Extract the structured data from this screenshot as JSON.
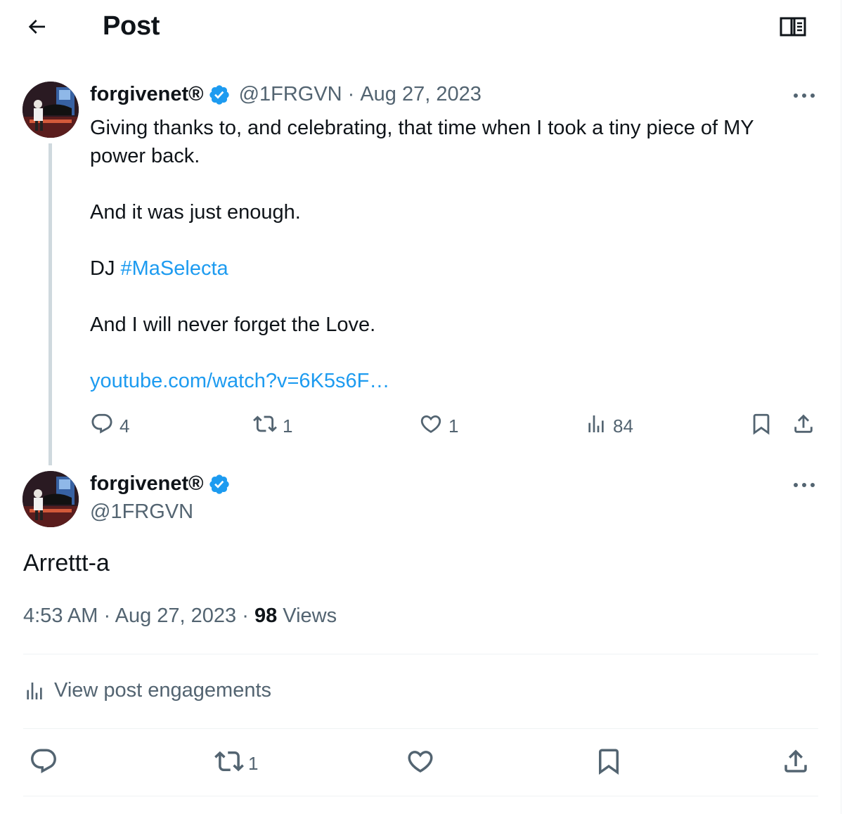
{
  "header": {
    "title": "Post",
    "back_icon": "arrow-left-icon",
    "reader_icon": "book-icon"
  },
  "parent_post": {
    "display_name": "forgivenet®",
    "handle": "@1FRGVN",
    "separator": "·",
    "date": "Aug 27, 2023",
    "text": {
      "line1": "Giving thanks to, and celebrating, that time when I took a tiny piece of MY power back.",
      "line2": "And it was just enough.",
      "dj_prefix": "DJ ",
      "hashtag": "#MaSelecta",
      "line4": "And I will never forget the Love.",
      "link": "youtube.com/watch?v=6K5s6F…"
    },
    "actions": {
      "replies": "4",
      "reposts": "1",
      "likes": "1",
      "views": "84"
    }
  },
  "main_post": {
    "display_name": "forgivenet®",
    "handle": "@1FRGVN",
    "text": "Arrettt-a",
    "time": "4:53 AM",
    "separator": "·",
    "date": "Aug 27, 2023",
    "views_count": "98",
    "views_label": "Views",
    "engagements_label": "View post engagements",
    "actions": {
      "reposts": "1"
    }
  },
  "colors": {
    "accent": "#1d9bf0",
    "muted": "#536471",
    "text": "#0f1419",
    "verified": "#1d9bf0",
    "thread_line": "#cfd9de"
  }
}
